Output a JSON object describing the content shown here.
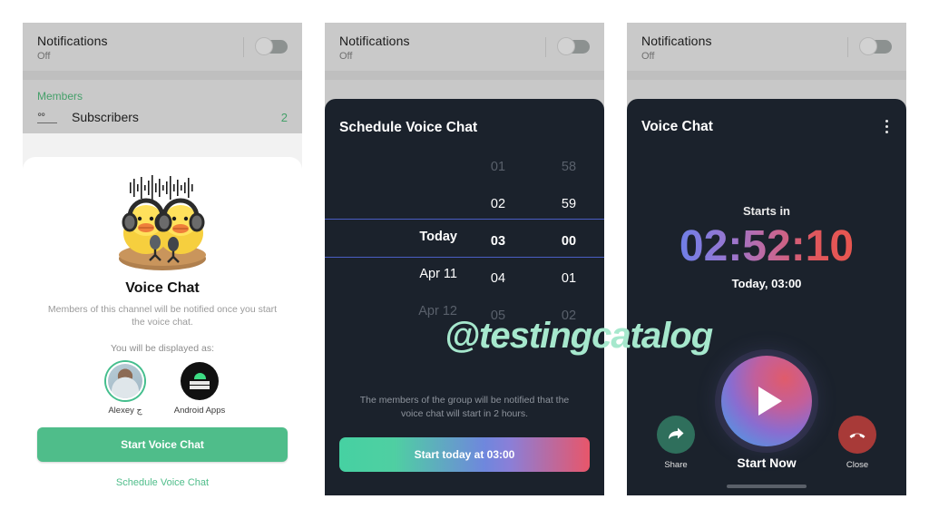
{
  "settings": {
    "notifications_label": "Notifications",
    "notifications_value": "Off",
    "members_header": "Members",
    "subscribers_label": "Subscribers",
    "subscribers_count": "2",
    "subscribers_icon": "people-icon",
    "toggle_state": "off"
  },
  "panel1": {
    "illustration": "ducks-with-headphones-and-microphones",
    "title": "Voice Chat",
    "description": "Members of this channel will be notified once you start the voice chat.",
    "displayed_as_label": "You will be displayed as:",
    "avatars": [
      {
        "name": "Alexey ج",
        "type": "user-photo",
        "selected": true
      },
      {
        "name": "Android Apps",
        "type": "channel-logo",
        "selected": false
      }
    ],
    "start_button": "Start Voice Chat",
    "schedule_link": "Schedule Voice Chat",
    "accent_color": "#4fbd8a"
  },
  "panel2": {
    "title": "Schedule Voice Chat",
    "picker": {
      "dates": [
        "",
        "",
        "Today",
        "Apr 11",
        "Apr 12"
      ],
      "hours": [
        "01",
        "02",
        "03",
        "04",
        "05"
      ],
      "minutes": [
        "58",
        "59",
        "00",
        "01",
        "02"
      ],
      "selected_index": 2,
      "selected_date": "Today",
      "selected_hour": "03",
      "selected_minute": "00",
      "selection_line_color": "#4a5ec4"
    },
    "note": "The members of the group will be notified that the voice chat will start in 2 hours.",
    "cta_button": "Start today at 03:00"
  },
  "panel3": {
    "title": "Voice Chat",
    "menu_icon": "kebab-menu-icon",
    "starts_in_label": "Starts in",
    "countdown": "02:52:10",
    "scheduled_for": "Today, 03:00",
    "controls": {
      "share_label": "Share",
      "share_icon": "share-arrow-icon",
      "start_label": "Start Now",
      "start_icon": "play-icon",
      "close_label": "Close",
      "close_icon": "phone-hangup-icon"
    },
    "countdown_gradient": [
      "#6f7fe8",
      "#c4689a",
      "#e8564f"
    ],
    "share_color": "#2f6f5c",
    "close_color": "#a83a38"
  },
  "watermark": "@testingcatalog"
}
